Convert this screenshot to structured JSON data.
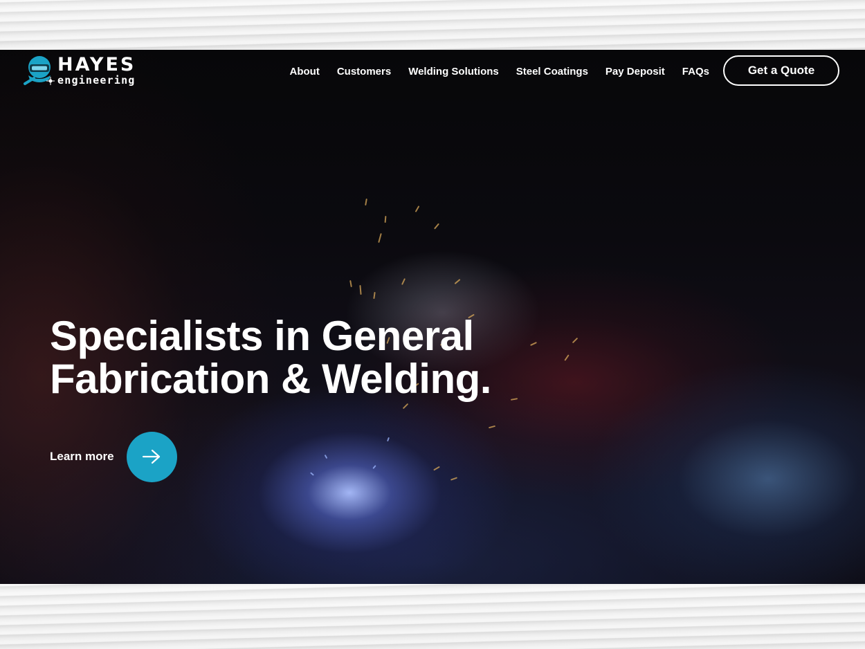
{
  "brand": {
    "title": "HAYES",
    "subtitle": "engineering",
    "accent_color": "#1ba3c6"
  },
  "nav": {
    "items": [
      {
        "label": "About"
      },
      {
        "label": "Customers"
      },
      {
        "label": "Welding Solutions"
      },
      {
        "label": "Steel Coatings"
      },
      {
        "label": "Pay Deposit"
      },
      {
        "label": "FAQs"
      }
    ],
    "cta_label": "Get a Quote"
  },
  "hero": {
    "headline_line1": "Specialists in General",
    "headline_line2": "Fabrication & Welding.",
    "learn_more_label": "Learn more",
    "arrow_icon": "arrow-right-icon",
    "background": "welding sparks photo"
  }
}
